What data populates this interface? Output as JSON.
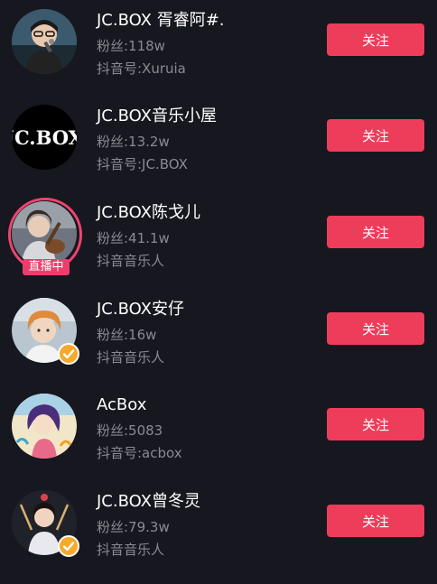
{
  "users": [
    {
      "name": "JC.BOX 胥睿阿#.",
      "fans": "粉丝:118w",
      "sub": "抖音号:Xuruia",
      "follow_label": "关注",
      "avatar_icon": "person-with-microphone"
    },
    {
      "name": "JC.BOX音乐小屋",
      "fans": "粉丝:13.2w",
      "sub": "抖音号:JC.BOX",
      "follow_label": "关注",
      "avatar_text": "JC.BOX"
    },
    {
      "name": "JC.BOX陈戈儿",
      "fans": "粉丝:41.1w",
      "sub": "抖音音乐人",
      "follow_label": "关注",
      "live_label": "直播中",
      "avatar_icon": "person-with-guitar"
    },
    {
      "name": "JC.BOX安仔",
      "fans": "粉丝:16w",
      "sub": "抖音音乐人",
      "follow_label": "关注",
      "avatar_icon": "person-orange-hair",
      "verified": true
    },
    {
      "name": "AcBox",
      "fans": "粉丝:5083",
      "sub": "抖音号:acbox",
      "follow_label": "关注",
      "avatar_icon": "anime-character"
    },
    {
      "name": "JC.BOX曾冬灵",
      "fans": "粉丝:79.3w",
      "sub": "抖音音乐人",
      "follow_label": "关注",
      "avatar_icon": "person-with-drumsticks",
      "verified": true
    }
  ],
  "colors": {
    "background": "#16171f",
    "follow_button": "#ed3d5a",
    "live_ring": "#f0436e",
    "verified_badge": "#f7a92c",
    "secondary_text": "#8a8b92"
  }
}
